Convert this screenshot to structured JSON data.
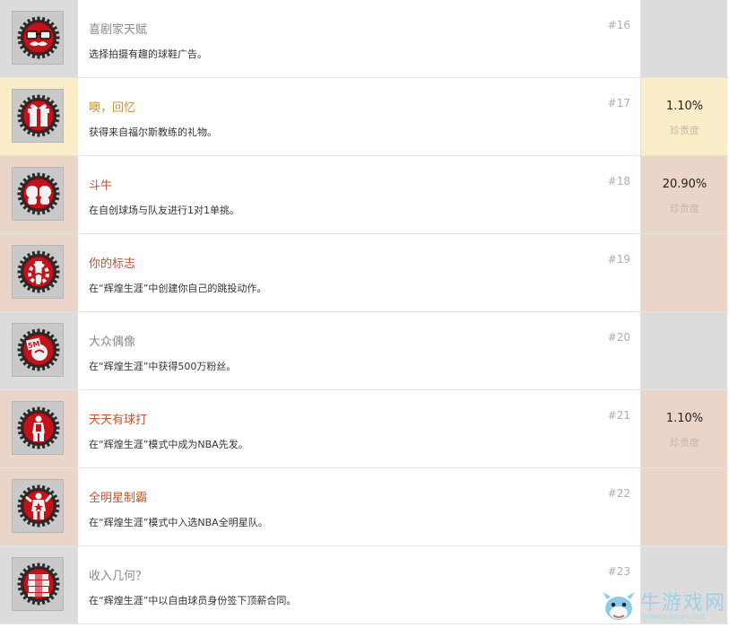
{
  "achievements": [
    {
      "title": "喜剧家天赋",
      "desc": "选择拍摄有趣的球鞋广告。",
      "num": "#16",
      "pct": "",
      "rare": "",
      "tier": "gray",
      "icon": "glasses-mustache-icon"
    },
    {
      "title": "噢，回忆",
      "desc": "获得来自福尔斯教练的礼物。",
      "num": "#17",
      "pct": "1.10%",
      "rare": "珍贵度",
      "tier": "gold",
      "icon": "gift-box-icon"
    },
    {
      "title": "斗牛",
      "desc": "在自创球场与队友进行1对1单挑。",
      "num": "#18",
      "pct": "20.90%",
      "rare": "珍贵度",
      "tier": "red",
      "icon": "two-heads-icon"
    },
    {
      "title": "你的标志",
      "desc": "在“辉煌生涯”中创建你自己的跳投动作。",
      "num": "#19",
      "pct": "",
      "rare": "",
      "tier": "red",
      "icon": "signature-gear-icon"
    },
    {
      "title": "大众偶像",
      "desc": "在“辉煌生涯”中获得500万粉丝。",
      "num": "#20",
      "pct": "",
      "rare": "",
      "tier": "gray",
      "icon": "5m-fans-icon"
    },
    {
      "title": "天天有球打",
      "desc": "在“辉煌生涯”模式中成为NBA先发。",
      "num": "#21",
      "pct": "1.10%",
      "rare": "珍贵度",
      "tier": "red",
      "icon": "player-starter-icon"
    },
    {
      "title": "全明星制霸",
      "desc": "在“辉煌生涯”模式中入选NBA全明星队。",
      "num": "#22",
      "pct": "",
      "rare": "",
      "tier": "red",
      "icon": "all-star-player-icon"
    },
    {
      "title": "收入几何？",
      "desc": "在“辉煌生涯”中以自由球员身份签下顶薪合同。",
      "num": "#23",
      "pct": "",
      "rare": "",
      "tier": "gray",
      "icon": "money-stack-icon"
    }
  ],
  "colors": {
    "gray_bg": "#dcdcdc",
    "gold_bg": "#fcedc9",
    "red_bg": "#ebd5c8",
    "badge_red": "#c4121a",
    "badge_dark": "#2a2a2a"
  },
  "watermark": {
    "text": "牛游戏网",
    "url": "www.newyx.net"
  }
}
